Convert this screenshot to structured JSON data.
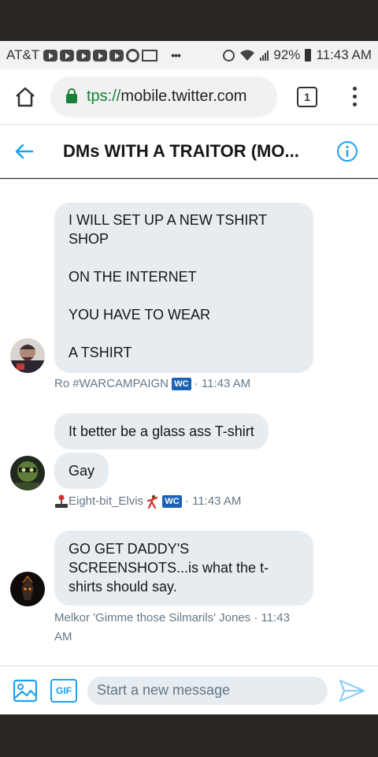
{
  "status_bar": {
    "carrier": "AT&T",
    "battery": "92%",
    "time": "11:43 AM"
  },
  "browser": {
    "url_scheme": "tps://",
    "url_host": "mobile.twitter.com",
    "tab_count": "1"
  },
  "header": {
    "title": "DMs WITH A TRAITOR (MO..."
  },
  "conversation": {
    "messages": [
      {
        "lines": [
          "I WILL SET UP A NEW TSHIRT",
          "SHOP",
          "",
          "ON THE INTERNET",
          "",
          "YOU HAVE TO WEAR",
          "",
          "A TSHIRT"
        ],
        "sender": "Ro #WARCAMPAIGN",
        "badge": "WC",
        "time": "11:43 AM"
      },
      {
        "bubbles": [
          "It better be a glass ass T-shirt",
          "Gay"
        ],
        "sender": "Eight-bit_Elvis",
        "badge": "WC",
        "time": "11:43 AM"
      },
      {
        "lines": [
          "GO GET DADDY'S",
          "SCREENSHOTS...is what the t-",
          "shirts should say."
        ],
        "sender": "Melkor 'Gimme those Silmarils' Jones",
        "time_line1": "11:43",
        "time_line2": "AM"
      }
    ]
  },
  "composer": {
    "gif_label": "GIF",
    "placeholder": "Start a new message"
  },
  "colors": {
    "accent": "#1da1f2",
    "bubble": "#e6ecf0",
    "secondary_text": "#657786",
    "badge": "#1d62b5"
  },
  "icons": [
    "home-icon",
    "lock-icon",
    "back-arrow-icon",
    "info-icon",
    "image-icon",
    "gif-icon",
    "send-icon",
    "joystick-icon",
    "dancer-icon",
    "alarm-icon",
    "wifi-icon",
    "signal-icon",
    "battery-icon"
  ]
}
